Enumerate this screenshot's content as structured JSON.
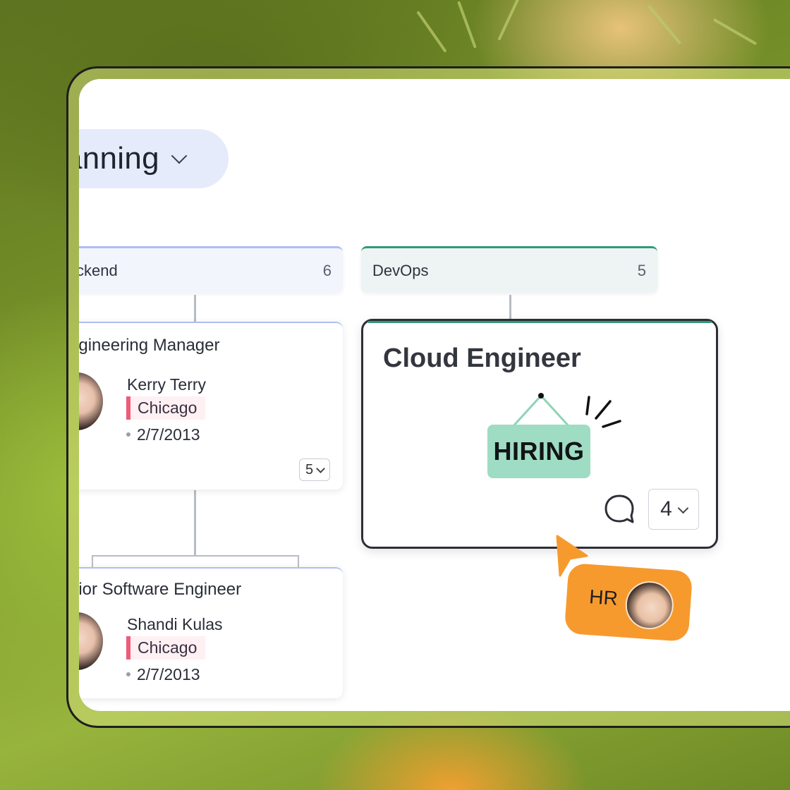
{
  "colors": {
    "backend_accent": "#aebff2",
    "devops_accent": "#2f9a7a",
    "location_accent": "#ee5c78",
    "hiring_sign": "#9fdcc4",
    "hr_bubble": "#f79a2e"
  },
  "selector": {
    "label": "anning"
  },
  "groups": [
    {
      "name": "ckend",
      "count": "6"
    },
    {
      "name": "DevOps",
      "count": "5"
    }
  ],
  "cards": {
    "eng_manager": {
      "role": "ngineering Manager",
      "person": "Kerry Terry",
      "location": "Chicago",
      "date": "2/7/2013",
      "reports": "5"
    },
    "senior_engineer": {
      "role": "nior Software Engineer",
      "person": "Shandi Kulas",
      "location": "Chicago",
      "date": "2/7/2013"
    },
    "cloud_engineer": {
      "role": "Cloud Engineer",
      "sign": "HIRING",
      "reports": "4"
    }
  },
  "comment_bubble": {
    "label": "HR"
  },
  "icons": [
    "chevron-down-icon",
    "comment-icon",
    "hiring-sign-icon",
    "attention-lines-icon",
    "cursor-pointer-icon"
  ]
}
